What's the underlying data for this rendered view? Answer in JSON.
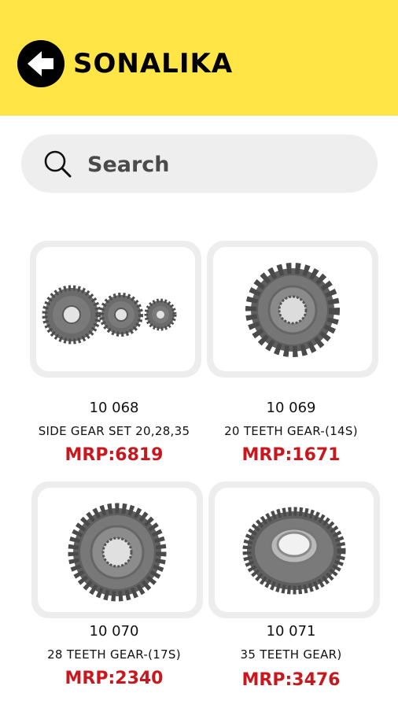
{
  "header": {
    "title": "SONALIKA",
    "back_icon": "arrow-left-icon",
    "background_color": "#ffe545"
  },
  "search": {
    "placeholder": "Search",
    "icon": "search-icon"
  },
  "products": [
    {
      "code": "10 068",
      "name": "SIDE GEAR SET 20,28,35",
      "price": "MRP:6819",
      "image_icon": "gear-set-icon"
    },
    {
      "code": "10 069",
      "name": "20 TEETH  GEAR-(14S)",
      "price": "MRP:1671",
      "image_icon": "gear-icon"
    },
    {
      "code": "10 070",
      "name": "28 TEETH  GEAR-(17S)",
      "price": "MRP:2340",
      "image_icon": "gear-icon"
    },
    {
      "code": "10 071",
      "name": "35 TEETH  GEAR)",
      "price": "MRP:3476",
      "image_icon": "gear-icon"
    }
  ],
  "colors": {
    "price": "#c8181e",
    "card_border": "#ededed",
    "search_bg": "#eeeeee"
  }
}
